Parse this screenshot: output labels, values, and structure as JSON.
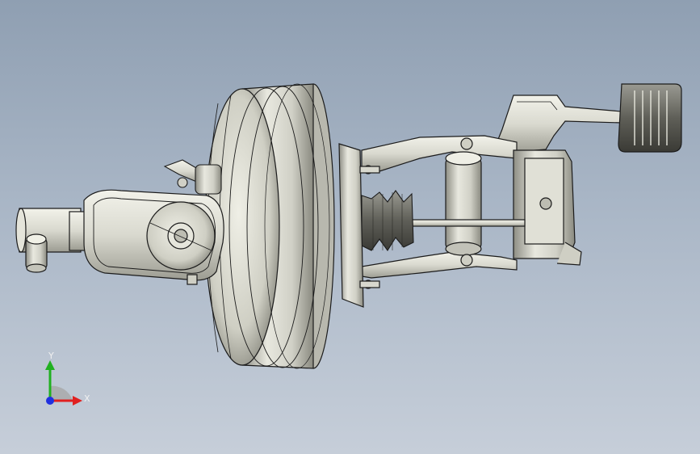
{
  "viewport": {
    "background_top": "#8f9fb2",
    "background_bottom": "#c6ced9"
  },
  "model": {
    "part_color": "#d8d8cc",
    "edge_color": "#1b1b1b",
    "components": [
      "brake-booster",
      "master-cylinder",
      "rubber-boot",
      "pedal-bracket",
      "pedal-arm",
      "brake-pedal-pad"
    ]
  },
  "triad": {
    "x_label": "X",
    "y_label": "Y",
    "x_color": "#e02020",
    "y_color": "#20b020",
    "z_color": "#2030e0"
  }
}
